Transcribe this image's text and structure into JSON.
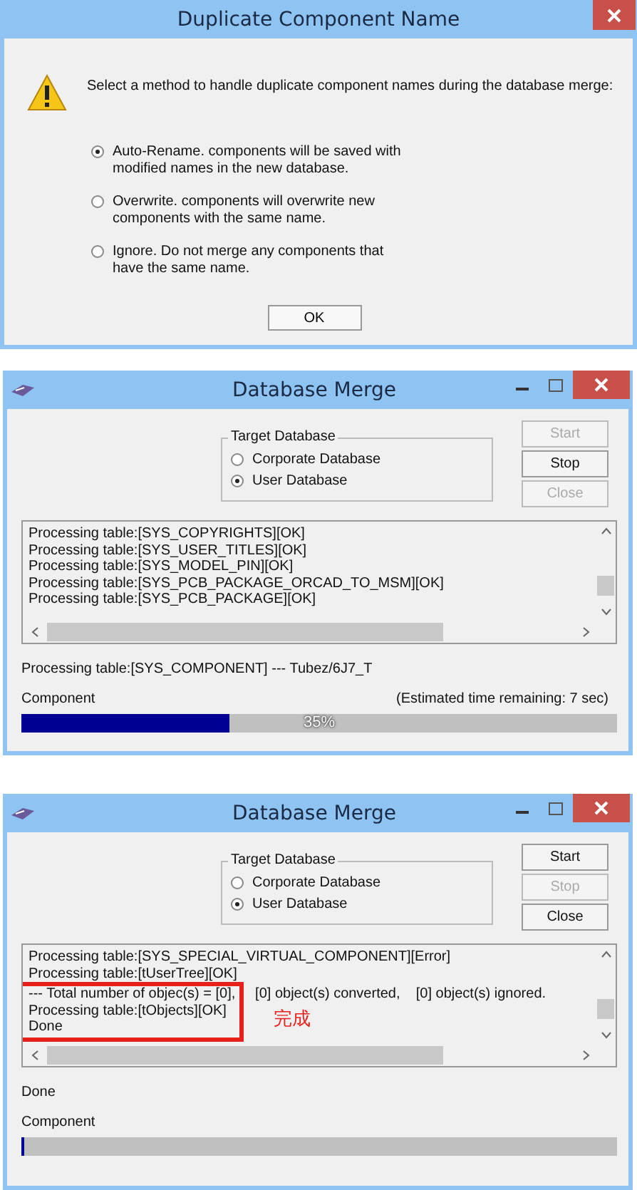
{
  "windows": [
    {
      "kind": "prompt",
      "title": "Duplicate Component Name",
      "message": "Select a method to handle duplicate component names during the database merge:",
      "options": [
        {
          "label": "Auto-Rename. components will be saved with\nmodified names in the new database.",
          "selected": true
        },
        {
          "label": "Overwrite. components will overwrite new\n components with the same name.",
          "selected": false
        },
        {
          "label": "Ignore. Do not merge any components that\n have the same name.",
          "selected": false
        }
      ],
      "ok": "OK"
    },
    {
      "kind": "merge",
      "title": "Database Merge",
      "group_title": "Target Database",
      "targets": [
        {
          "label": "Corporate Database",
          "selected": false
        },
        {
          "label": "User Database",
          "selected": true
        }
      ],
      "buttons": [
        {
          "label": "Start",
          "disabled": true
        },
        {
          "label": "Stop",
          "disabled": false
        },
        {
          "label": "Close",
          "disabled": true
        }
      ],
      "log": [
        "Processing table:[SYS_COPYRIGHTS][OK]",
        "Processing table:[SYS_USER_TITLES][OK]",
        "Processing table:[SYS_MODEL_PIN][OK]",
        "Processing table:[SYS_PCB_PACKAGE_ORCAD_TO_MSM][OK]",
        "Processing table:[SYS_PCB_PACKAGE][OK]"
      ],
      "status": "Processing table:[SYS_COMPONENT] --- Tubez/6J7_T",
      "progress": {
        "label": "Component",
        "estimate": "(Estimated time remaining: 7 sec)",
        "level": 0.35,
        "reading": "35%"
      }
    },
    {
      "kind": "merge",
      "title": "Database Merge",
      "group_title": "Target Database",
      "targets": [
        {
          "label": "Corporate Database",
          "selected": false
        },
        {
          "label": "User Database",
          "selected": true
        }
      ],
      "buttons": [
        {
          "label": "Start",
          "disabled": false
        },
        {
          "label": "Stop",
          "disabled": true
        },
        {
          "label": "Close",
          "disabled": false
        }
      ],
      "log": [
        "Processing table:[SYS_SPECIAL_VIRTUAL_COMPONENT][Error]",
        "Processing table:[tUserTree][OK]"
      ],
      "highlight": {
        "lines": [
          "--- Total number of objec(s) = [0],     [0] object(s) converted,    [0] object(s) ignored.",
          "Processing table:[tObjects][OK]",
          "Done"
        ],
        "note": "完成"
      },
      "status": "Done",
      "progress": {
        "label": "Component",
        "level": 0.005
      }
    }
  ]
}
